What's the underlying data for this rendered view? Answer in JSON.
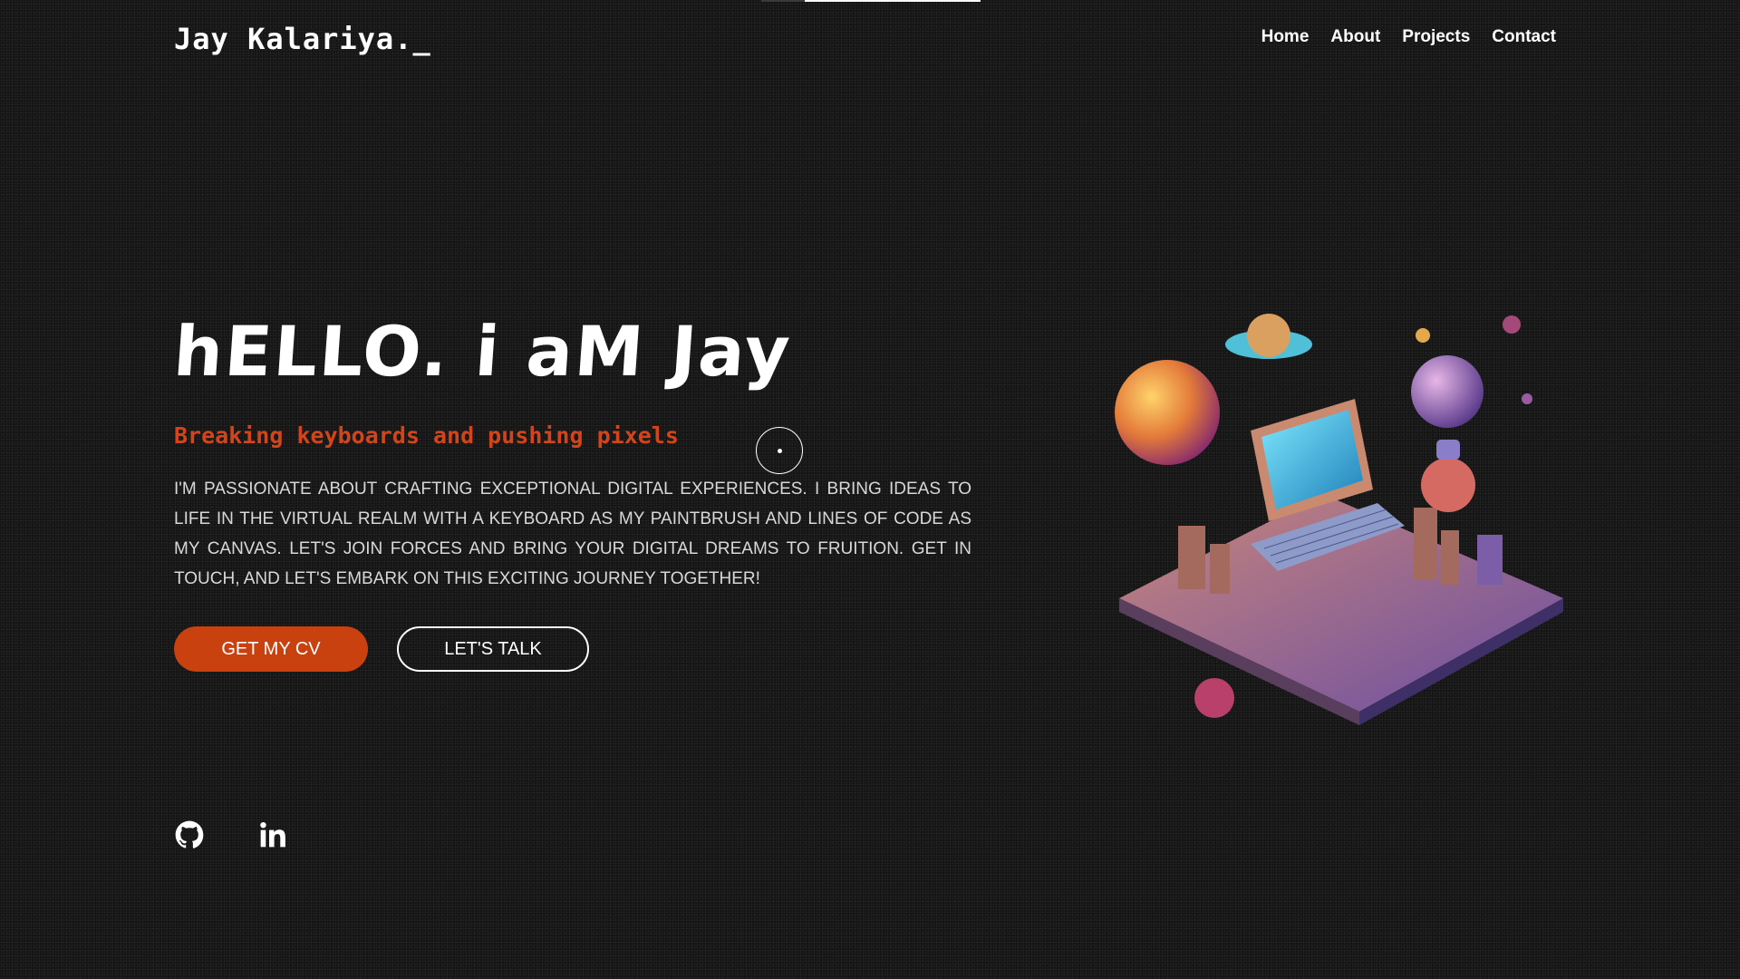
{
  "header": {
    "logo": "Jay Kalariya._",
    "nav": [
      "Home",
      "About",
      "Projects",
      "Contact"
    ]
  },
  "hero": {
    "title": "hELLO. i aM Jay",
    "subtitle": "Breaking keyboards and pushing pixels",
    "description": "I'M PASSIONATE ABOUT CRAFTING EXCEPTIONAL DIGITAL EXPERIENCES. I BRING IDEAS TO LIFE IN THE VIRTUAL REALM WITH A KEYBOARD AS MY PAINTBRUSH AND LINES OF CODE AS MY CANVAS. LET'S JOIN FORCES AND BRING YOUR DIGITAL DREAMS TO FRUITION. GET IN TOUCH, AND LET'S EMBARK ON THIS EXCITING JOURNEY TOGETHER!",
    "primary_button": "GET MY CV",
    "secondary_button": "LET'S TALK"
  },
  "socials": [
    {
      "icon": "github-icon"
    },
    {
      "icon": "linkedin-icon"
    }
  ],
  "colors": {
    "background": "#141414",
    "accent": "#c8410f",
    "subtitle": "#d2451a",
    "text": "#ffffff",
    "body_text": "#d8d8d8"
  }
}
